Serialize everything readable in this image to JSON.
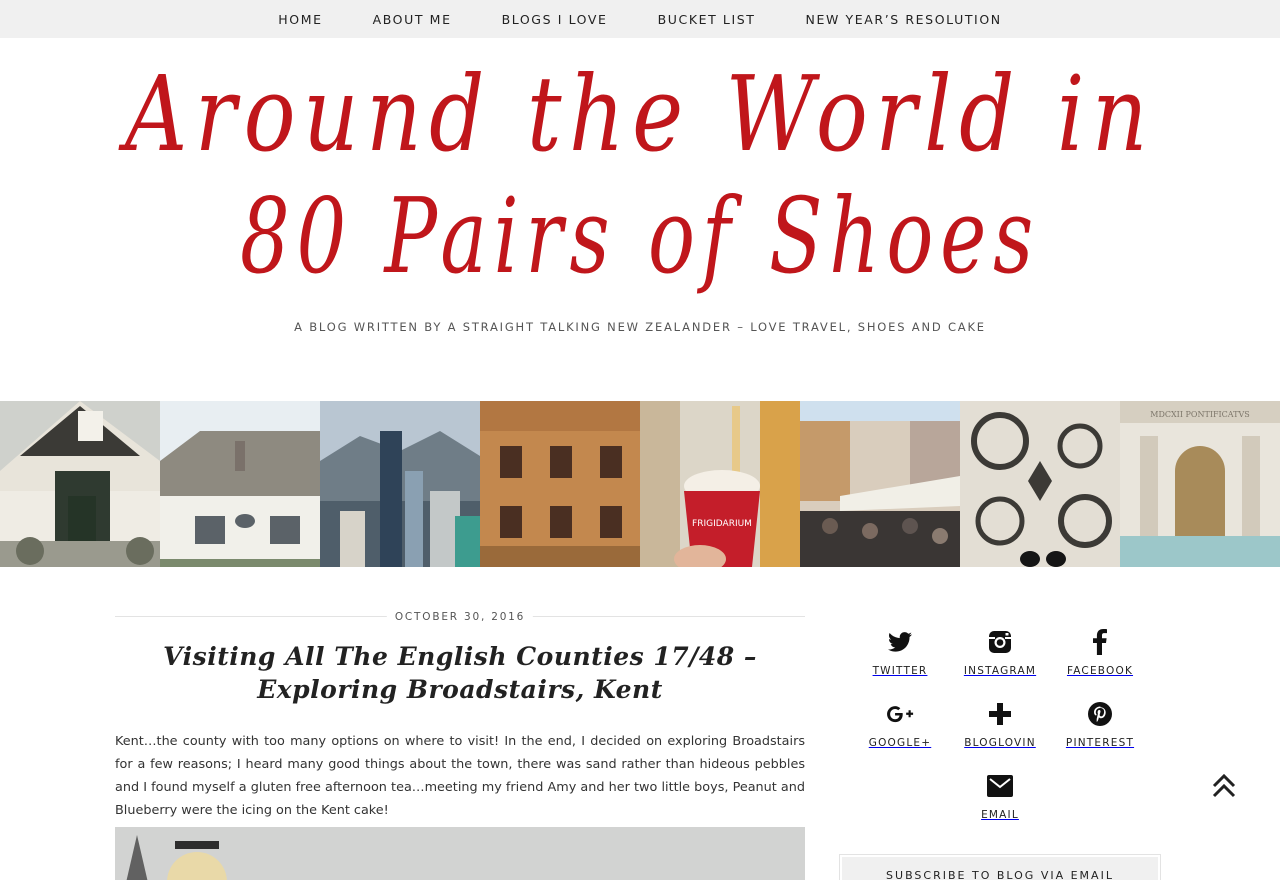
{
  "nav": {
    "items": [
      {
        "label": "HOME"
      },
      {
        "label": "ABOUT ME"
      },
      {
        "label": "BLOGS I LOVE"
      },
      {
        "label": "BUCKET LIST"
      },
      {
        "label": "NEW YEAR’S RESOLUTION"
      }
    ]
  },
  "header": {
    "logo_line1": "Around the World in",
    "logo_line2": "80 Pairs of Shoes",
    "tagline": "A BLOG WRITTEN BY A STRAIGHT TALKING NEW ZEALANDER – LOVE TRAVEL, SHOES AND CAKE",
    "logo_color": "#c0161b"
  },
  "post": {
    "date": "OCTOBER 30, 2016",
    "title": "Visiting All The English Counties 17/48 – Exploring Broadstairs, Kent",
    "body": "Kent…the county with too many options on where to visit!  In the end, I decided on exploring Broadstairs for a few reasons; I heard many good things about the town, there was sand rather than hideous pebbles and I found myself a gluten free afternoon tea…meeting my friend Amy and her two little boys, Peanut and Blueberry were the icing on the Kent cake!"
  },
  "sidebar": {
    "social": [
      {
        "label": "TWITTER",
        "icon": "twitter-icon"
      },
      {
        "label": "INSTAGRAM",
        "icon": "instagram-icon"
      },
      {
        "label": "FACEBOOK",
        "icon": "facebook-icon"
      },
      {
        "label": "GOOGLE+",
        "icon": "google-plus-icon"
      },
      {
        "label": "BLOGLOVIN",
        "icon": "bloglovin-icon"
      },
      {
        "label": "PINTEREST",
        "icon": "pinterest-icon"
      },
      {
        "label": "EMAIL",
        "icon": "email-icon"
      }
    ],
    "subscribe_title": "SUBSCRIBE TO BLOG VIA EMAIL"
  },
  "colors": {
    "accent": "#c0161b",
    "nav_bg": "#f0f0f0"
  }
}
